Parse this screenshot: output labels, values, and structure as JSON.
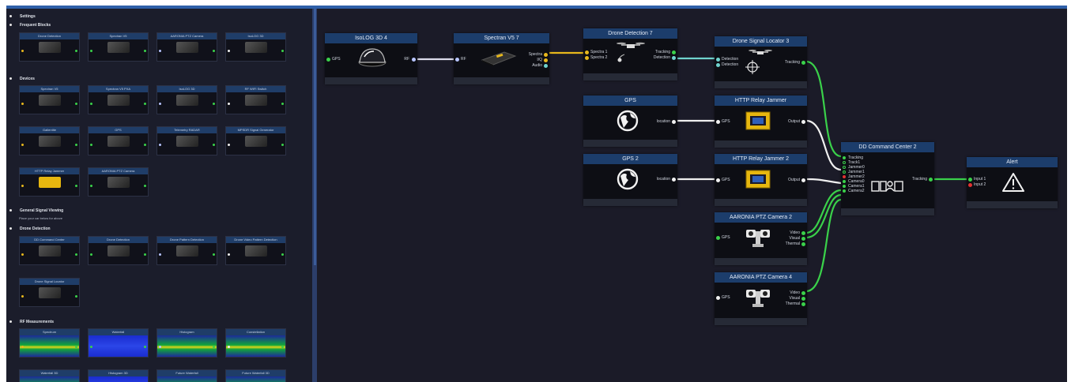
{
  "palette": {
    "sections": {
      "settings": "Settings",
      "frequent": "Frequent Blocks",
      "devices": "Devices",
      "general": "General Signal Viewing",
      "general_hint": "Place your car below for above",
      "drone": "Drone Detection",
      "rf": "RF Measurements"
    },
    "frequent_blocks": [
      "Drone Detection",
      "Spectran V5",
      "AARONIA PTZ Camera",
      "IsoLOG 3D"
    ],
    "devices_row1": [
      "Spectran V5",
      "Spectran V5 PXA",
      "IsoLOG 3D",
      "RF WIFI Switch"
    ],
    "devices_row2": [
      "Gallentite",
      "GPS",
      "Telemetry RADAR",
      "MPSDR Signal Generator"
    ],
    "devices_row3": [
      "HTTP Relay Jammer",
      "AARONIA PTZ Camera"
    ],
    "drone_row1": [
      "DD Command Center",
      "Drone Detection",
      "Drone Pattern Detection",
      "Drone Video Pattern Detection"
    ],
    "drone_row2": [
      "Drone Signal Locator"
    ],
    "rf_row1": [
      "Spectrum",
      "Waterfall",
      "Histogram",
      "Constellation"
    ],
    "rf_row2": [
      "Waterfall 3D",
      "Histogram 3D",
      "Future Waterfall",
      "Future Waterfall 3D"
    ]
  },
  "nodes": {
    "isolog": {
      "title": "IsoLOG 3D 4",
      "in": "GPS",
      "out": "RF"
    },
    "spectran": {
      "title": "Spectran V5 7",
      "in": "RF",
      "out": [
        "Spectra",
        "I/Q",
        "Audio"
      ]
    },
    "drone_det": {
      "title": "Drone Detection 7",
      "in": [
        "Spectra 1",
        "Spectra 2"
      ],
      "out": [
        "Tracking",
        "Detection"
      ]
    },
    "locator": {
      "title": "Drone Signal Locator 3",
      "in": [
        "Detection",
        "Detection"
      ],
      "out": "Tracking"
    },
    "gps1": {
      "title": "GPS",
      "out": "location"
    },
    "gps2": {
      "title": "GPS 2",
      "out": "location"
    },
    "jammer1": {
      "title": "HTTP Relay Jammer",
      "in": "GPS",
      "out": "Output"
    },
    "jammer2": {
      "title": "HTTP Relay Jammer 2",
      "in": "GPS",
      "out": "Output"
    },
    "cam2": {
      "title": "AARONIA PTZ Camera 2",
      "in": "GPS",
      "out": [
        "Video",
        "Visual",
        "Thermal"
      ]
    },
    "cam4": {
      "title": "AARONIA PTZ Camera 4",
      "in": "GPS",
      "out": [
        "Video",
        "Visual",
        "Thermal"
      ]
    },
    "dd": {
      "title": "DD Command Center 2",
      "in": [
        "Tracking",
        "Track1",
        "Jammer0",
        "Jammer1",
        "Jammer2",
        "Camera0",
        "Camera1",
        "Camera2"
      ],
      "out": "Tracking"
    },
    "alert": {
      "title": "Alert",
      "in": [
        "Input 1",
        "Input 2"
      ]
    }
  },
  "colors": {
    "accent": "#2e5fa8",
    "node_header": "#1c3d6b",
    "link_green": "#3ad14a",
    "link_yellow": "#e8b81c",
    "link_white": "#f0f0f0",
    "alert_red": "#e23232"
  }
}
